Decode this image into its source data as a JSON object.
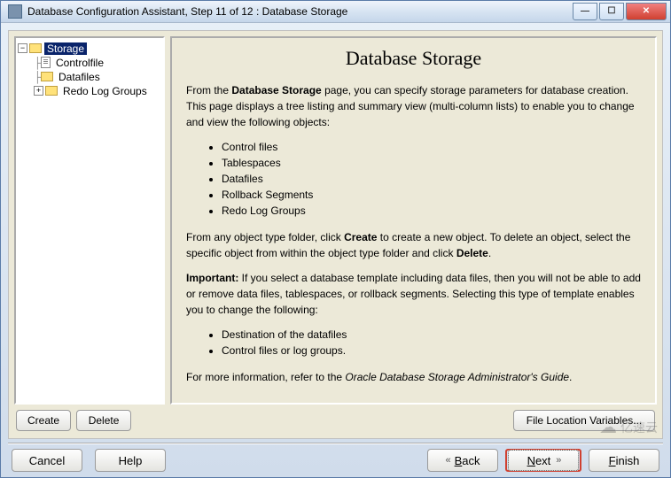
{
  "window": {
    "title": "Database Configuration Assistant, Step 11 of 12 : Database Storage"
  },
  "tree": {
    "root": "Storage",
    "controlfile": "Controlfile",
    "datafiles": "Datafiles",
    "redolog": "Redo Log Groups"
  },
  "detail": {
    "heading": "Database Storage",
    "p1_pre": "From the ",
    "p1_bold": "Database Storage",
    "p1_post": " page, you can specify storage parameters for database creation. This page displays a tree listing and summary view (multi-column lists) to enable you to change and view the following objects:",
    "bullets1": {
      "b1": "Control files",
      "b2": "Tablespaces",
      "b3": "Datafiles",
      "b4": "Rollback Segments",
      "b5": "Redo Log Groups"
    },
    "p2_a": "From any object type folder, click ",
    "p2_create": "Create",
    "p2_b": " to create a new object. To delete an object, select the specific object from within the object type folder and click ",
    "p2_delete": "Delete",
    "p2_c": ".",
    "p3_bold": "Important:",
    "p3_rest": " If you select a database template including data files, then you will not be able to add or remove data files, tablespaces, or rollback segments. Selecting this type of template enables you to change the following:",
    "bullets2": {
      "b1": "Destination of the datafiles",
      "b2": "Control files or log groups."
    },
    "p4_a": "For more information, refer to the ",
    "p4_guide": "Oracle Database Storage Administrator's Guide",
    "p4_b": "."
  },
  "buttons": {
    "create": "Create",
    "delete": "Delete",
    "fileloc": "File Location Variables...",
    "cancel": "Cancel",
    "help": "Help",
    "back": "Back",
    "next": "Next",
    "finish": "Finish"
  },
  "watermark": "亿速云"
}
